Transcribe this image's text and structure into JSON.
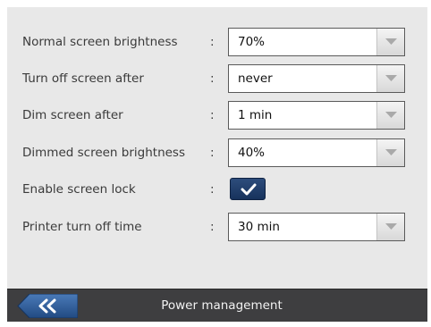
{
  "settings": [
    {
      "label": "Normal screen brightness",
      "separator": ":",
      "value": "70%"
    },
    {
      "label": "Turn off screen after",
      "separator": ":",
      "value": "never"
    },
    {
      "label": "Dim screen after",
      "separator": ":",
      "value": "1 min"
    },
    {
      "label": "Dimmed screen brightness",
      "separator": ":",
      "value": "40%"
    },
    {
      "label": "Enable screen lock",
      "separator": ":",
      "checked": true
    },
    {
      "label": "Printer turn off time",
      "separator": ":",
      "value": "30 min"
    }
  ],
  "footer": {
    "title": "Power management",
    "back_icon": "double-chevron-left-icon"
  },
  "colors": {
    "panel_bg": "#e8e8e8",
    "footer_bg": "#3e3e40",
    "checkbox_bg": "#1f3c6a",
    "back_button": "#2f5c9a"
  }
}
